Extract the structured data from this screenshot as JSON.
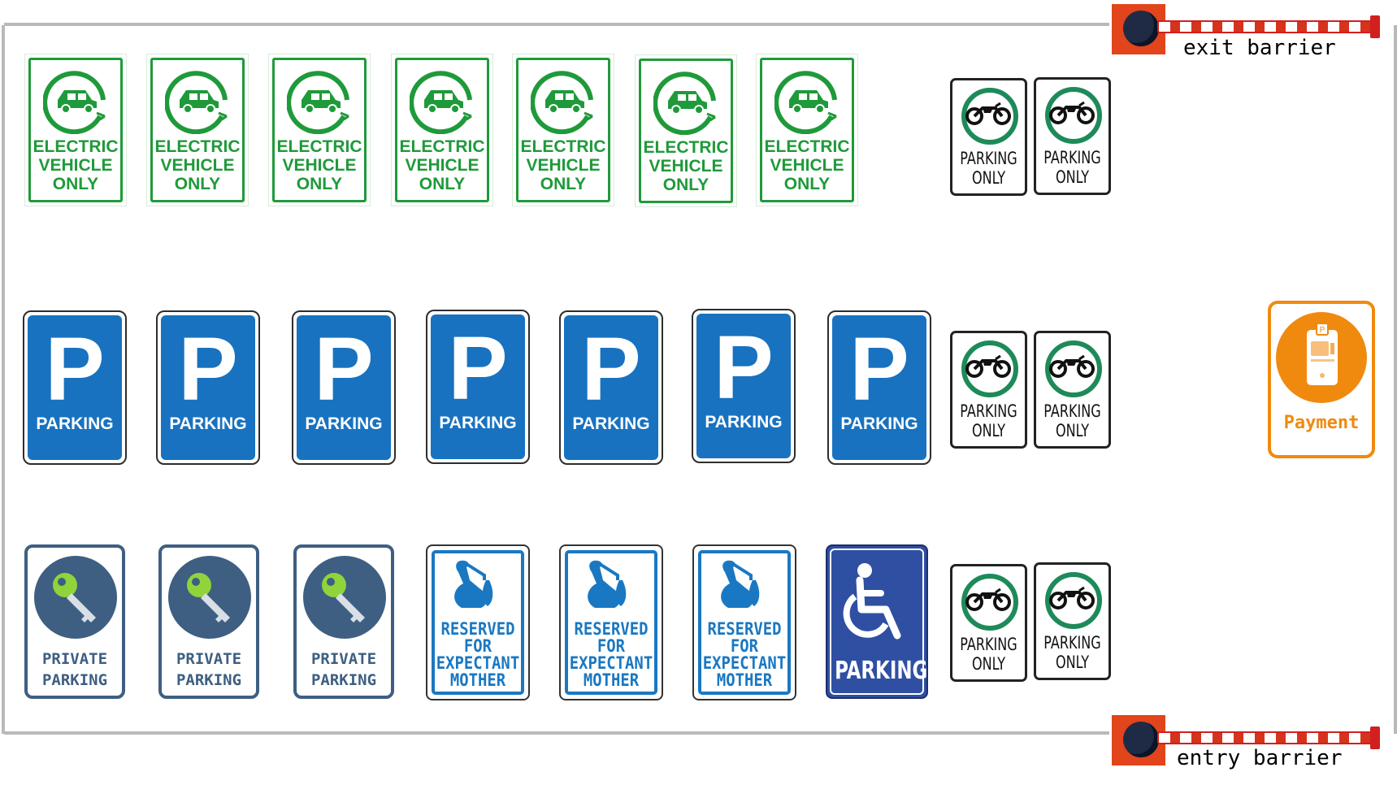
{
  "barriers": {
    "exit": "exit barrier",
    "entry": "entry barrier"
  },
  "rows": [
    {
      "type": "electric-vehicle",
      "count": 7,
      "sign_text": [
        "ELECTRIC",
        "VEHICLE",
        "ONLY"
      ],
      "color": "#1f9a3a"
    },
    {
      "type": "parking",
      "count": 7,
      "symbol": "P",
      "sign_text": "PARKING",
      "color": "#1872c0"
    },
    {
      "type": "mixed",
      "private": {
        "count": 3,
        "sign_text": [
          "PRIVATE",
          "PARKING"
        ],
        "color": "#3e5f82"
      },
      "expectant": {
        "count": 3,
        "sign_text": [
          "RESERVED",
          "FOR",
          "EXPECTANT",
          "MOTHER"
        ],
        "color": "#1a78c2"
      },
      "handicap": {
        "count": 1,
        "sign_text": "PARKING",
        "color": "#2f4fa3"
      }
    }
  ],
  "motorcycle": {
    "per_row": 2,
    "sign_text": [
      "PARKING",
      "ONLY"
    ],
    "color": "#1e8a5a"
  },
  "payment": {
    "label": "Payment",
    "color": "#f08a0f"
  }
}
